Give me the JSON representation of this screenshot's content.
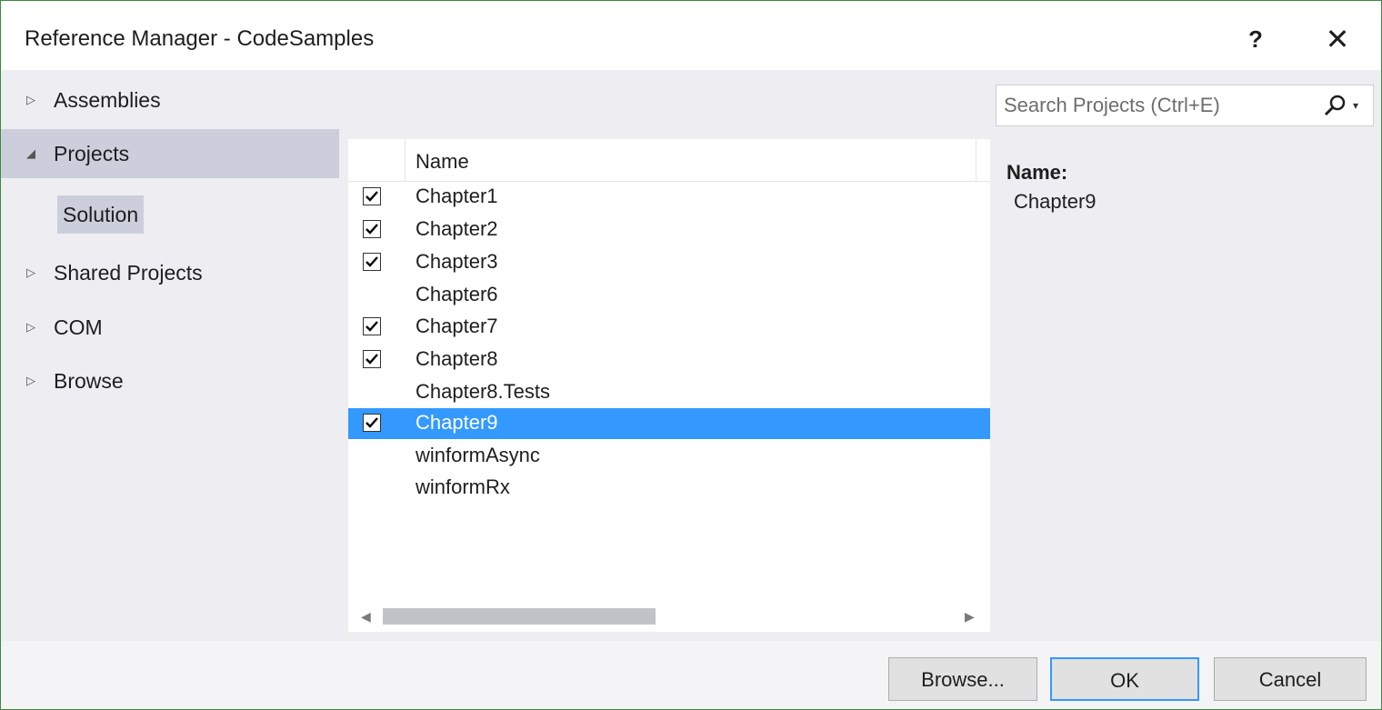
{
  "window": {
    "title": "Reference Manager - CodeSamples",
    "help_glyph": "?",
    "close_glyph": "✕"
  },
  "sidebar": {
    "items": [
      {
        "label": "Assemblies",
        "arrow": "▷",
        "selected": false
      },
      {
        "label": "Projects",
        "arrow": "◢",
        "selected": true
      },
      {
        "label": "Shared Projects",
        "arrow": "▷",
        "selected": false
      },
      {
        "label": "COM",
        "arrow": "▷",
        "selected": false
      },
      {
        "label": "Browse",
        "arrow": "▷",
        "selected": false
      }
    ],
    "sub_item": "Solution"
  },
  "search": {
    "placeholder": "Search Projects (Ctrl+E)",
    "dropdown_glyph": "▾"
  },
  "list": {
    "column_name": "Name",
    "rows": [
      {
        "name": "Chapter1",
        "checked": true,
        "selected": false
      },
      {
        "name": "Chapter2",
        "checked": true,
        "selected": false
      },
      {
        "name": "Chapter3",
        "checked": true,
        "selected": false
      },
      {
        "name": "Chapter6",
        "checked": false,
        "selected": false
      },
      {
        "name": "Chapter7",
        "checked": true,
        "selected": false
      },
      {
        "name": "Chapter8",
        "checked": true,
        "selected": false
      },
      {
        "name": "Chapter8.Tests",
        "checked": false,
        "selected": false
      },
      {
        "name": "Chapter9",
        "checked": true,
        "selected": true
      },
      {
        "name": "winformAsync",
        "checked": false,
        "selected": false
      },
      {
        "name": "winformRx",
        "checked": false,
        "selected": false
      }
    ],
    "scroll_left_glyph": "◀",
    "scroll_right_glyph": "▶"
  },
  "detail": {
    "label": "Name:",
    "value": "Chapter9"
  },
  "footer": {
    "browse_label": "Browse...",
    "ok_label": "OK",
    "cancel_label": "Cancel"
  },
  "colors": {
    "selection": "#3399ff",
    "sidebar_selected": "#cccedb",
    "window_border": "#3c8a3f"
  }
}
